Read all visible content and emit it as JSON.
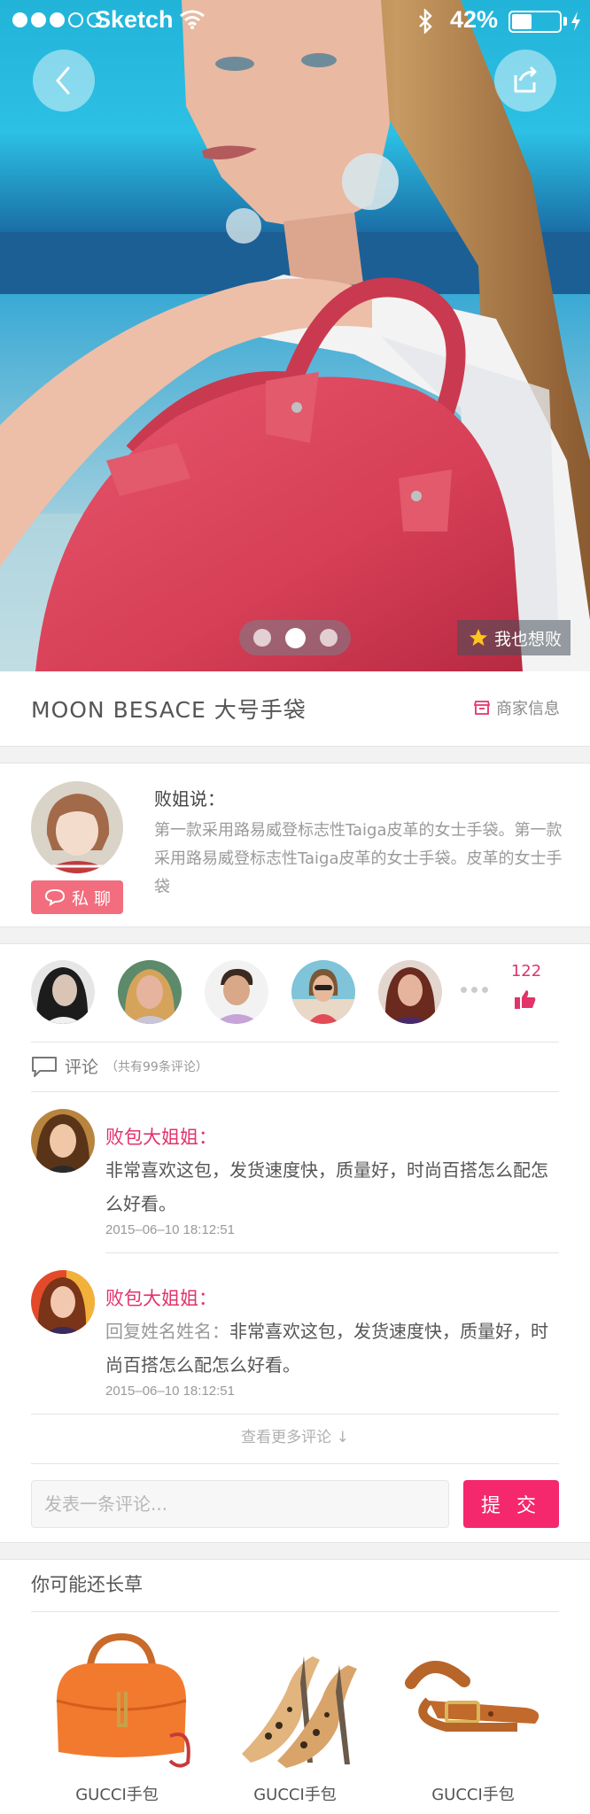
{
  "status_bar": {
    "carrier": "Sketch",
    "battery_percent": "42%",
    "signal_bars": 3,
    "signal_total": 5,
    "battery_level": 0.42
  },
  "hero": {
    "back_icon": "chevron-left-icon",
    "share_icon": "share-icon",
    "pages": 3,
    "active_page": 2,
    "want_label": "我也想败"
  },
  "product": {
    "title": "MOON BESACE 大号手袋",
    "merchant_label": "商家信息"
  },
  "seller": {
    "label": "败姐说：",
    "description": "第一款采用路易威登标志性Taiga皮革的女士手袋。第一款采用路易威登标志性Taiga皮革的女士手袋。皮革的女士手袋",
    "chat_label": "私 聊"
  },
  "likes": {
    "count": "122",
    "avatars": [
      "liker-1",
      "liker-2",
      "liker-3",
      "liker-4",
      "liker-5"
    ]
  },
  "comments": {
    "title": "评论",
    "count_text": "（共有99条评论）",
    "items": [
      {
        "name": "败包大姐姐：",
        "reply_to": "",
        "text": "非常喜欢这包，发货速度快，质量好，时尚百搭怎么配怎么好看。",
        "time": "2015–06–10  18:12:51"
      },
      {
        "name": "败包大姐姐：",
        "reply_to": "回复姓名姓名：",
        "text": "非常喜欢这包，发货速度快，质量好，时尚百搭怎么配怎么好看。",
        "time": "2015–06–10  18:12:51"
      }
    ],
    "more_label": "查看更多评论 ↓",
    "input_placeholder": "发表一条评论...",
    "submit_label": "提 交"
  },
  "recommendations": {
    "title": "你可能还长草",
    "items": [
      {
        "label": "GUCCI手包"
      },
      {
        "label": "GUCCI手包"
      },
      {
        "label": "GUCCI手包"
      }
    ]
  },
  "colors": {
    "accent": "#f5276d",
    "name_pink": "#e2336a",
    "chat_button": "#f26d7d",
    "bag_red": "#d9455c"
  }
}
